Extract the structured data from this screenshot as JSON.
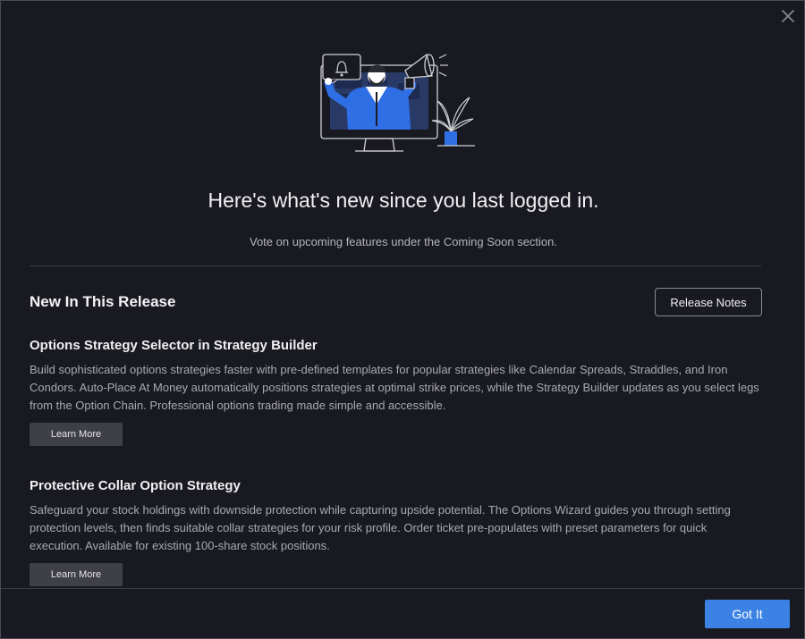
{
  "dialog": {
    "headline": "Here's what's new since you last logged in.",
    "subline": "Vote on upcoming features under the Coming Soon section.",
    "close_icon": "close-icon",
    "hero_illustration": "megaphone-announcement-illustration"
  },
  "release": {
    "section_title": "New In This Release",
    "release_notes_label": "Release Notes",
    "features": [
      {
        "title": "Options Strategy Selector in Strategy Builder",
        "description": "Build sophisticated options strategies faster with pre-defined templates for popular strategies like Calendar Spreads, Straddles, and Iron Condors. Auto-Place At Money automatically positions strategies at optimal strike prices, while the Strategy Builder updates as you select legs from the Option Chain. Professional options trading made simple and accessible.",
        "button_label": "Learn More"
      },
      {
        "title": "Protective Collar Option Strategy",
        "description": "Safeguard your stock holdings with downside protection while capturing upside potential. The Options Wizard guides you through setting protection levels, then finds suitable collar strategies for your risk profile. Order ticket pre-populates with preset parameters for quick execution. Available for existing 100-share stock positions.",
        "button_label": "Learn More"
      }
    ]
  },
  "footer": {
    "got_it_label": "Got It"
  },
  "colors": {
    "background": "#191a21",
    "accent_blue": "#3b82e4",
    "illustration_blue": "#2f6fe6"
  }
}
